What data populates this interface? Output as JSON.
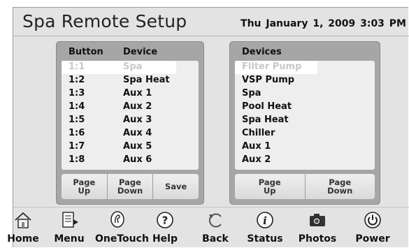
{
  "header": {
    "title": "Spa Remote Setup",
    "datetime": "Thu January 1, 2009  3:03 PM"
  },
  "assignments": {
    "col_button": "Button",
    "col_device": "Device",
    "rows": [
      {
        "button": "1:1",
        "device": "Spa",
        "selected": true
      },
      {
        "button": "1:2",
        "device": "Spa Heat"
      },
      {
        "button": "1:3",
        "device": "Aux 1"
      },
      {
        "button": "1:4",
        "device": "Aux 2"
      },
      {
        "button": "1:5",
        "device": "Aux 3"
      },
      {
        "button": "1:6",
        "device": "Aux 4"
      },
      {
        "button": "1:7",
        "device": "Aux 5"
      },
      {
        "button": "1:8",
        "device": "Aux 6"
      }
    ],
    "buttons": {
      "page_up": "Page\nUp",
      "page_down": "Page\nDown",
      "save": "Save"
    }
  },
  "devices": {
    "heading": "Devices",
    "items": [
      {
        "label": "Filter Pump",
        "selected": true
      },
      {
        "label": "VSP Pump"
      },
      {
        "label": "Spa"
      },
      {
        "label": "Pool Heat"
      },
      {
        "label": "Spa Heat"
      },
      {
        "label": "Chiller"
      },
      {
        "label": "Aux 1"
      },
      {
        "label": "Aux 2"
      }
    ],
    "buttons": {
      "page_up": "Page\nUp",
      "page_down": "Page\nDown"
    }
  },
  "nav": [
    {
      "label": "Home",
      "icon": "home-icon"
    },
    {
      "label": "Menu",
      "icon": "menu-icon"
    },
    {
      "label": "OneTouch",
      "icon": "onetouch-icon"
    },
    {
      "label": "Help",
      "icon": "help-icon"
    },
    {
      "label": "Back",
      "icon": "back-icon"
    },
    {
      "label": "Status",
      "icon": "status-icon"
    },
    {
      "label": "Photos",
      "icon": "photos-icon"
    },
    {
      "label": "Power",
      "icon": "power-icon"
    }
  ]
}
